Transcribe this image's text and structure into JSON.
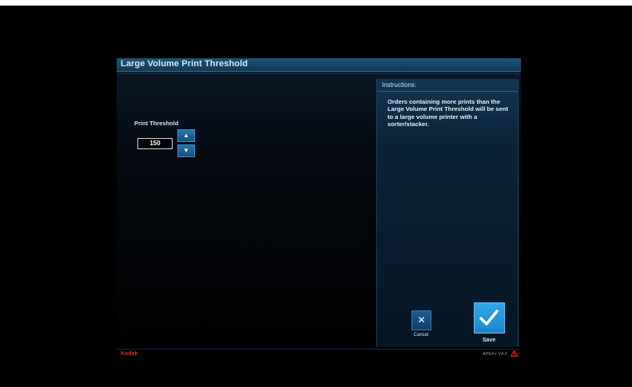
{
  "window": {
    "title": "Large Volume Print Threshold"
  },
  "threshold": {
    "label": "Print Threshold",
    "value": "150",
    "up_icon": "arrow-up-icon",
    "down_icon": "arrow-down-icon"
  },
  "instructions": {
    "header": "Instructions:",
    "body": "Orders containing more prints than the Large Volume Print Threshold will be sent to a large volume printer with a sorter/stacker."
  },
  "actions": {
    "cancel_label": "Cancel",
    "cancel_icon": "close-icon",
    "save_label": "Save",
    "save_icon": "checkmark-icon"
  },
  "footer": {
    "brand": "Kodak",
    "version": "APEX+ V4.0",
    "warning_icon": "warning-icon"
  },
  "colors": {
    "accent": "#2a74a8",
    "save": "#32a7e8",
    "brand": "#e4231a"
  }
}
